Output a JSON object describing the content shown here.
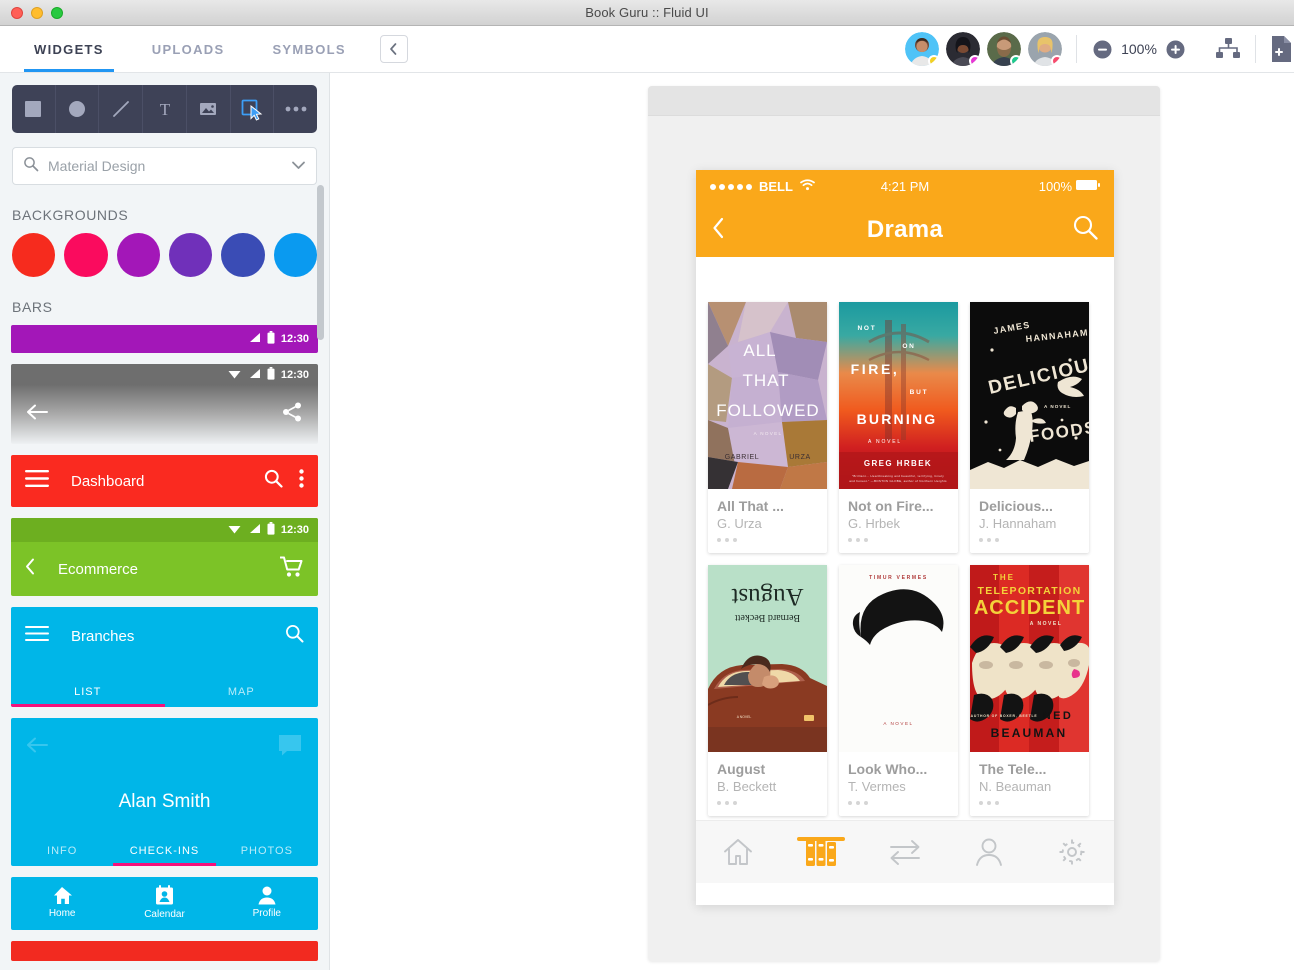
{
  "window": {
    "title": "Book Guru :: Fluid UI"
  },
  "header": {
    "tabs": [
      {
        "label": "WIDGETS",
        "active": true
      },
      {
        "label": "UPLOADS",
        "active": false
      },
      {
        "label": "SYMBOLS",
        "active": false
      }
    ],
    "collapse_icon": "chevron-left-icon",
    "avatars": [
      {
        "name": "avatar-1",
        "status_color": "#F2D024"
      },
      {
        "name": "avatar-2",
        "status_color": "#E838D6"
      },
      {
        "name": "avatar-3",
        "status_color": "#1FC98E"
      },
      {
        "name": "avatar-4",
        "status_color": "#F74C6E"
      }
    ],
    "zoom": {
      "minus": "minus-circle-icon",
      "level": "100%",
      "plus": "plus-circle-icon"
    },
    "sitemap_icon": "sitemap-icon",
    "newpage_icon": "new-page-icon"
  },
  "sidebar": {
    "tools": [
      {
        "name": "rectangle-tool",
        "icon": "square-icon",
        "active": false
      },
      {
        "name": "ellipse-tool",
        "icon": "circle-icon",
        "active": false
      },
      {
        "name": "line-tool",
        "icon": "line-icon",
        "active": false
      },
      {
        "name": "text-tool",
        "icon": "text-t-icon",
        "active": false
      },
      {
        "name": "image-tool",
        "icon": "image-icon",
        "active": false
      },
      {
        "name": "select-tool",
        "icon": "select-cursor-icon",
        "active": true
      },
      {
        "name": "more-tools",
        "icon": "ellipsis-icon",
        "active": false
      }
    ],
    "search": {
      "placeholder": "Material Design",
      "value": "",
      "icon": "search-icon",
      "chevron": "chevron-down-icon"
    },
    "backgrounds": {
      "title": "BACKGROUNDS",
      "colors": [
        "#F62B1E",
        "#FA0B5E",
        "#A317B8",
        "#7030BA",
        "#3A4CB5",
        "#0A9AF0"
      ]
    },
    "bars": {
      "title": "BARS",
      "items": [
        {
          "name": "purple-status-bar",
          "color": "#A317B8",
          "time": "12:30",
          "kind": "status-only"
        },
        {
          "name": "grey-gradient-bar",
          "color": "#6e6e6e",
          "time": "12:30",
          "kind": "back-share"
        },
        {
          "name": "dashboard-bar",
          "color": "#FA2A20",
          "title": "Dashboard",
          "kind": "menu-search-more"
        },
        {
          "name": "ecommerce-bar",
          "color": "#7CC327",
          "title": "Ecommerce",
          "time": "12:30",
          "kind": "back-cart"
        },
        {
          "name": "branches-bar",
          "color": "#00B6E8",
          "title": "Branches",
          "kind": "tabs",
          "tabs": [
            "LIST",
            "MAP"
          ],
          "active_tab": 0
        },
        {
          "name": "profile-bar",
          "color": "#00B6E8",
          "title": "Alan Smith",
          "kind": "profile-tabs",
          "tabs": [
            "INFO",
            "CHECK-INS",
            "PHOTOS"
          ],
          "active_tab": 1
        },
        {
          "name": "bottom-nav-bar",
          "color": "#00B6E8",
          "kind": "bottom-nav",
          "items": [
            {
              "label": "Home",
              "icon": "home-icon"
            },
            {
              "label": "Calendar",
              "icon": "calendar-icon"
            },
            {
              "label": "Profile",
              "icon": "person-icon"
            }
          ]
        },
        {
          "name": "red-bar",
          "color": "#F22A20",
          "kind": "partial"
        }
      ]
    }
  },
  "phone": {
    "status": {
      "signal_dots": 5,
      "carrier": "BELL",
      "wifi": "wifi-icon",
      "time": "4:21 PM",
      "battery": "100%"
    },
    "nav": {
      "back_icon": "chevron-left-icon",
      "title": "Drama",
      "search_icon": "search-icon"
    },
    "books": [
      {
        "title": "All That ...",
        "author": "G. Urza",
        "cover": "all-that-followed"
      },
      {
        "title": "Not on Fire...",
        "author": "G. Hrbek",
        "cover": "not-on-fire-but-burning"
      },
      {
        "title": "Delicious...",
        "author": "J. Hannaham",
        "cover": "delicious-foods"
      },
      {
        "title": "August",
        "author": "B. Beckett",
        "cover": "august"
      },
      {
        "title": "Look Who...",
        "author": "T. Vermes",
        "cover": "look-whos-back"
      },
      {
        "title": "The Tele...",
        "author": "N. Beauman",
        "cover": "the-teleportation-accident"
      }
    ],
    "covers": {
      "all_that_followed": {
        "line1": "ALL",
        "line2": "THAT",
        "line3": "FOLLOWED",
        "sub": "A NOVEL",
        "author_first": "GABRIEL",
        "author_last": "URZA"
      },
      "not_on_fire": {
        "w1": "NOT",
        "w2": "ON",
        "w3": "FIRE,",
        "w4": "BUT",
        "w5": "BURNING",
        "sub": "A NOVEL",
        "author": "GREG HRBEK"
      },
      "delicious_foods": {
        "author1": "JAMES",
        "author2": "HANNAHAM",
        "t1": "DELICIOUS",
        "t2": "FOODS",
        "sub": "A NOVEL"
      },
      "august": {
        "title": "August",
        "author": "Bernard Beckett"
      },
      "look_whos_back": {
        "author": "TIMUR VERMES",
        "sub": "A NOVEL"
      },
      "teleportation": {
        "t1": "THE",
        "t2": "TELEPORTATION",
        "t3": "ACCIDENT",
        "sub": "A NOVEL",
        "blurb": "AUTHOR OF BOXER, BEETLE",
        "author1": "NED",
        "author2": "BEAUMAN"
      }
    },
    "tabbar": [
      {
        "name": "tab-home",
        "icon": "home-outline-icon",
        "active": false
      },
      {
        "name": "tab-books",
        "icon": "books-icon",
        "active": true
      },
      {
        "name": "tab-exchange",
        "icon": "exchange-arrows-icon",
        "active": false
      },
      {
        "name": "tab-profile",
        "icon": "person-outline-icon",
        "active": false
      },
      {
        "name": "tab-settings",
        "icon": "gear-icon",
        "active": false
      }
    ],
    "accent": "#FAA81A"
  }
}
